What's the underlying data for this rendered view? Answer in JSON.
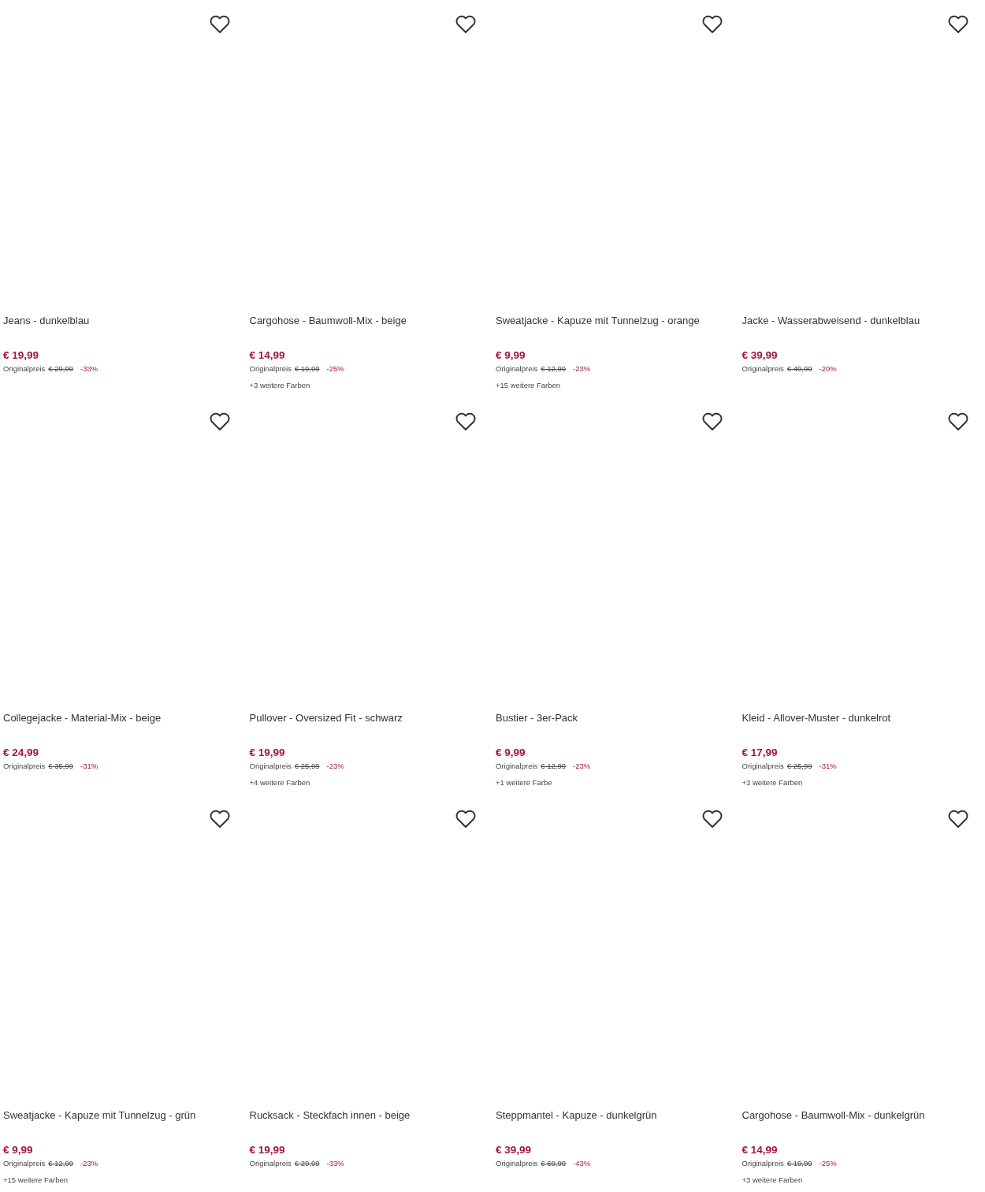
{
  "products": [
    {
      "title": "Jeans - dunkelblau",
      "price": "€ 19,99",
      "original_label": "Originalpreis",
      "original_price": "€ 29,99",
      "discount": "-33%"
    },
    {
      "title": "Cargohose - Baumwoll-Mix - beige",
      "price": "€ 14,99",
      "original_label": "Originalpreis",
      "original_price": "€ 19,99",
      "discount": "-25%",
      "more_colors": "+3 weitere Farben"
    },
    {
      "title": "Sweatjacke - Kapuze mit Tunnelzug - orange",
      "price": "€ 9,99",
      "original_label": "Originalpreis",
      "original_price": "€ 12,99",
      "discount": "-23%",
      "more_colors": "+15 weitere Farben"
    },
    {
      "title": "Jacke - Wasserabweisend - dunkelblau",
      "price": "€ 39,99",
      "original_label": "Originalpreis",
      "original_price": "€ 49,99",
      "discount": "-20%"
    },
    {
      "title": "Collegejacke - Material-Mix - beige",
      "price": "€ 24,99",
      "original_label": "Originalpreis",
      "original_price": "€ 35,99",
      "discount": "-31%"
    },
    {
      "title": "Pullover - Oversized Fit - schwarz",
      "price": "€ 19,99",
      "original_label": "Originalpreis",
      "original_price": "€ 25,99",
      "discount": "-23%",
      "more_colors": "+4 weitere Farben"
    },
    {
      "title": "Bustier - 3er-Pack",
      "price": "€ 9,99",
      "original_label": "Originalpreis",
      "original_price": "€ 12,99",
      "discount": "-23%",
      "more_colors": "+1 weitere Farbe"
    },
    {
      "title": "Kleid - Allover-Muster - dunkelrot",
      "price": "€ 17,99",
      "original_label": "Originalpreis",
      "original_price": "€ 25,99",
      "discount": "-31%",
      "more_colors": "+3 weitere Farben"
    },
    {
      "title": "Sweatjacke - Kapuze mit Tunnelzug - grün",
      "price": "€ 9,99",
      "original_label": "Originalpreis",
      "original_price": "€ 12,99",
      "discount": "-23%",
      "more_colors": "+15 weitere Farben"
    },
    {
      "title": "Rucksack - Steckfach innen - beige",
      "price": "€ 19,99",
      "original_label": "Originalpreis",
      "original_price": "€ 29,99",
      "discount": "-33%"
    },
    {
      "title": "Steppmantel - Kapuze - dunkelgrün",
      "price": "€ 39,99",
      "original_label": "Originalpreis",
      "original_price": "€ 69,99",
      "discount": "-43%"
    },
    {
      "title": "Cargohose - Baumwoll-Mix - dunkelgrün",
      "price": "€ 14,99",
      "original_label": "Originalpreis",
      "original_price": "€ 19,99",
      "discount": "-25%",
      "more_colors": "+3 weitere Farben"
    }
  ]
}
